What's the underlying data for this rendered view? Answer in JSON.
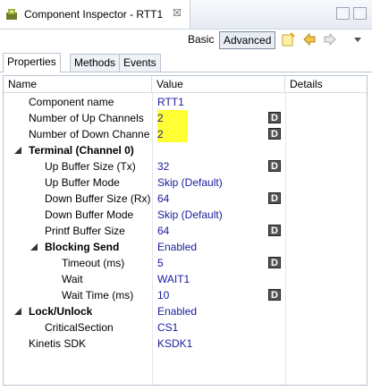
{
  "title": {
    "text": "Component Inspector - RTT1",
    "close": "☒"
  },
  "toolbar": {
    "basic": "Basic",
    "advanced": "Advanced"
  },
  "tabs": [
    "Properties",
    "Methods",
    "Events"
  ],
  "headers": {
    "name": "Name",
    "value": "Value",
    "details": "Details"
  },
  "rows": [
    {
      "name": "Component name",
      "value": "RTT1"
    },
    {
      "name": "Number of Up Channels",
      "value": "2"
    },
    {
      "name": "Number of Down Channe",
      "value": "2"
    },
    {
      "name": "Terminal (Channel 0)",
      "value": ""
    },
    {
      "name": "Up Buffer Size (Tx)",
      "value": "32"
    },
    {
      "name": "Up Buffer Mode",
      "value": "Skip (Default)"
    },
    {
      "name": "Down Buffer Size (Rx)",
      "value": "64"
    },
    {
      "name": "Down Buffer Mode",
      "value": "Skip (Default)"
    },
    {
      "name": "Printf Buffer Size",
      "value": "64"
    },
    {
      "name": "Blocking Send",
      "value": "Enabled"
    },
    {
      "name": "Timeout (ms)",
      "value": "5"
    },
    {
      "name": "Wait",
      "value": "WAIT1"
    },
    {
      "name": "Wait Time (ms)",
      "value": "10"
    },
    {
      "name": "Lock/Unlock",
      "value": "Enabled"
    },
    {
      "name": "CriticalSection",
      "value": "CS1"
    },
    {
      "name": "Kinetis SDK",
      "value": "KSDK1"
    }
  ],
  "d_label": "D",
  "colors": {
    "value_text": "#1a1a9c",
    "highlight": "#ffff33"
  }
}
